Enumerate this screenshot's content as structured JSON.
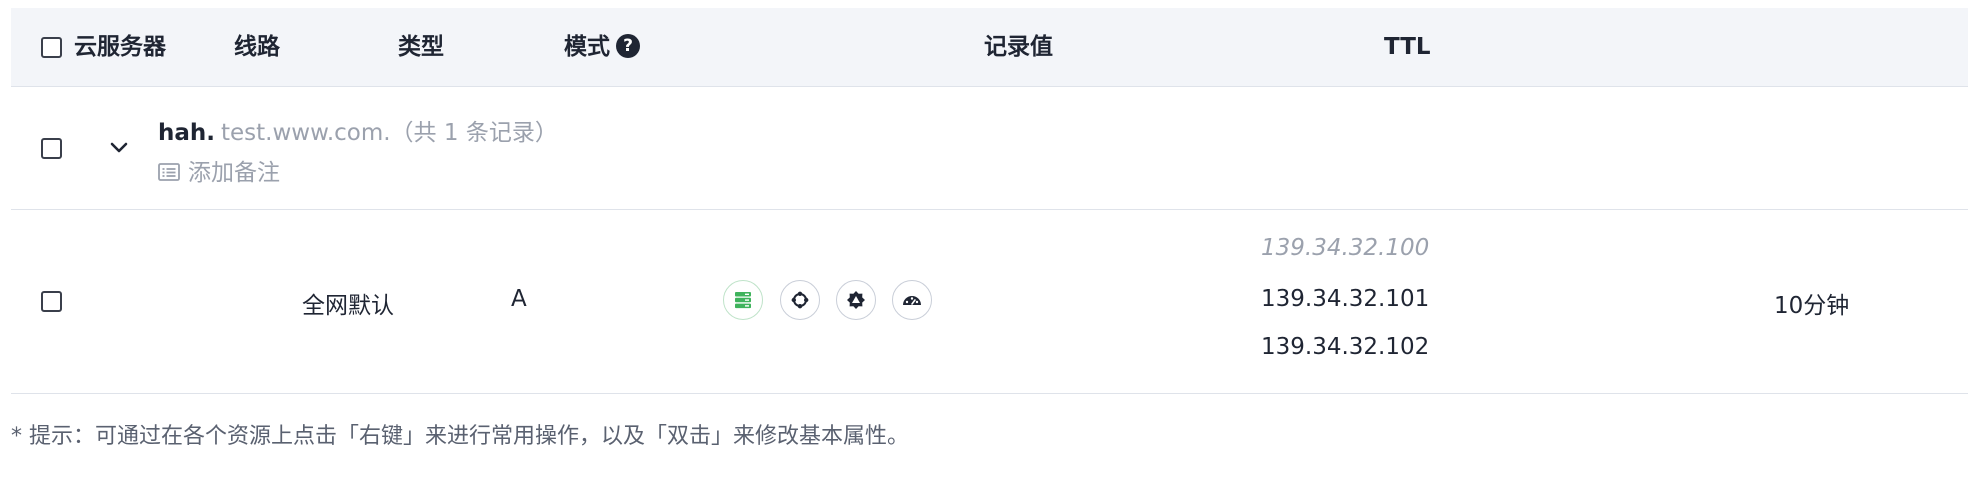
{
  "table": {
    "columns": {
      "server": "云服务器",
      "line": "线路",
      "type": "类型",
      "mode": "模式",
      "value": "记录值",
      "ttl": "TTL"
    },
    "mode_help_icon": "question-circle-icon",
    "group": {
      "subdomain": "hah.",
      "domain_info": "test.www.com.（共 1 条记录）",
      "add_note": "添加备注",
      "expand_icon": "chevron-down-icon",
      "note_icon": "note-icon"
    },
    "record": {
      "line": "全网默认",
      "type": "A",
      "mode_icons": [
        "server-icon",
        "load-balance-icon",
        "settings-icon",
        "dashboard-icon"
      ],
      "values": [
        "139.34.32.100",
        "139.34.32.101",
        "139.34.32.102"
      ],
      "ttl": "10分钟"
    }
  },
  "tip": "* 提示：可通过在各个资源上点击「右键」来进行常用操作，以及「双击」来修改基本属性。",
  "colors": {
    "header_bg": "#f3f5f9",
    "border": "#dfe3ea",
    "muted_text": "#9ba1ad",
    "accent_green": "#3fb35c"
  }
}
